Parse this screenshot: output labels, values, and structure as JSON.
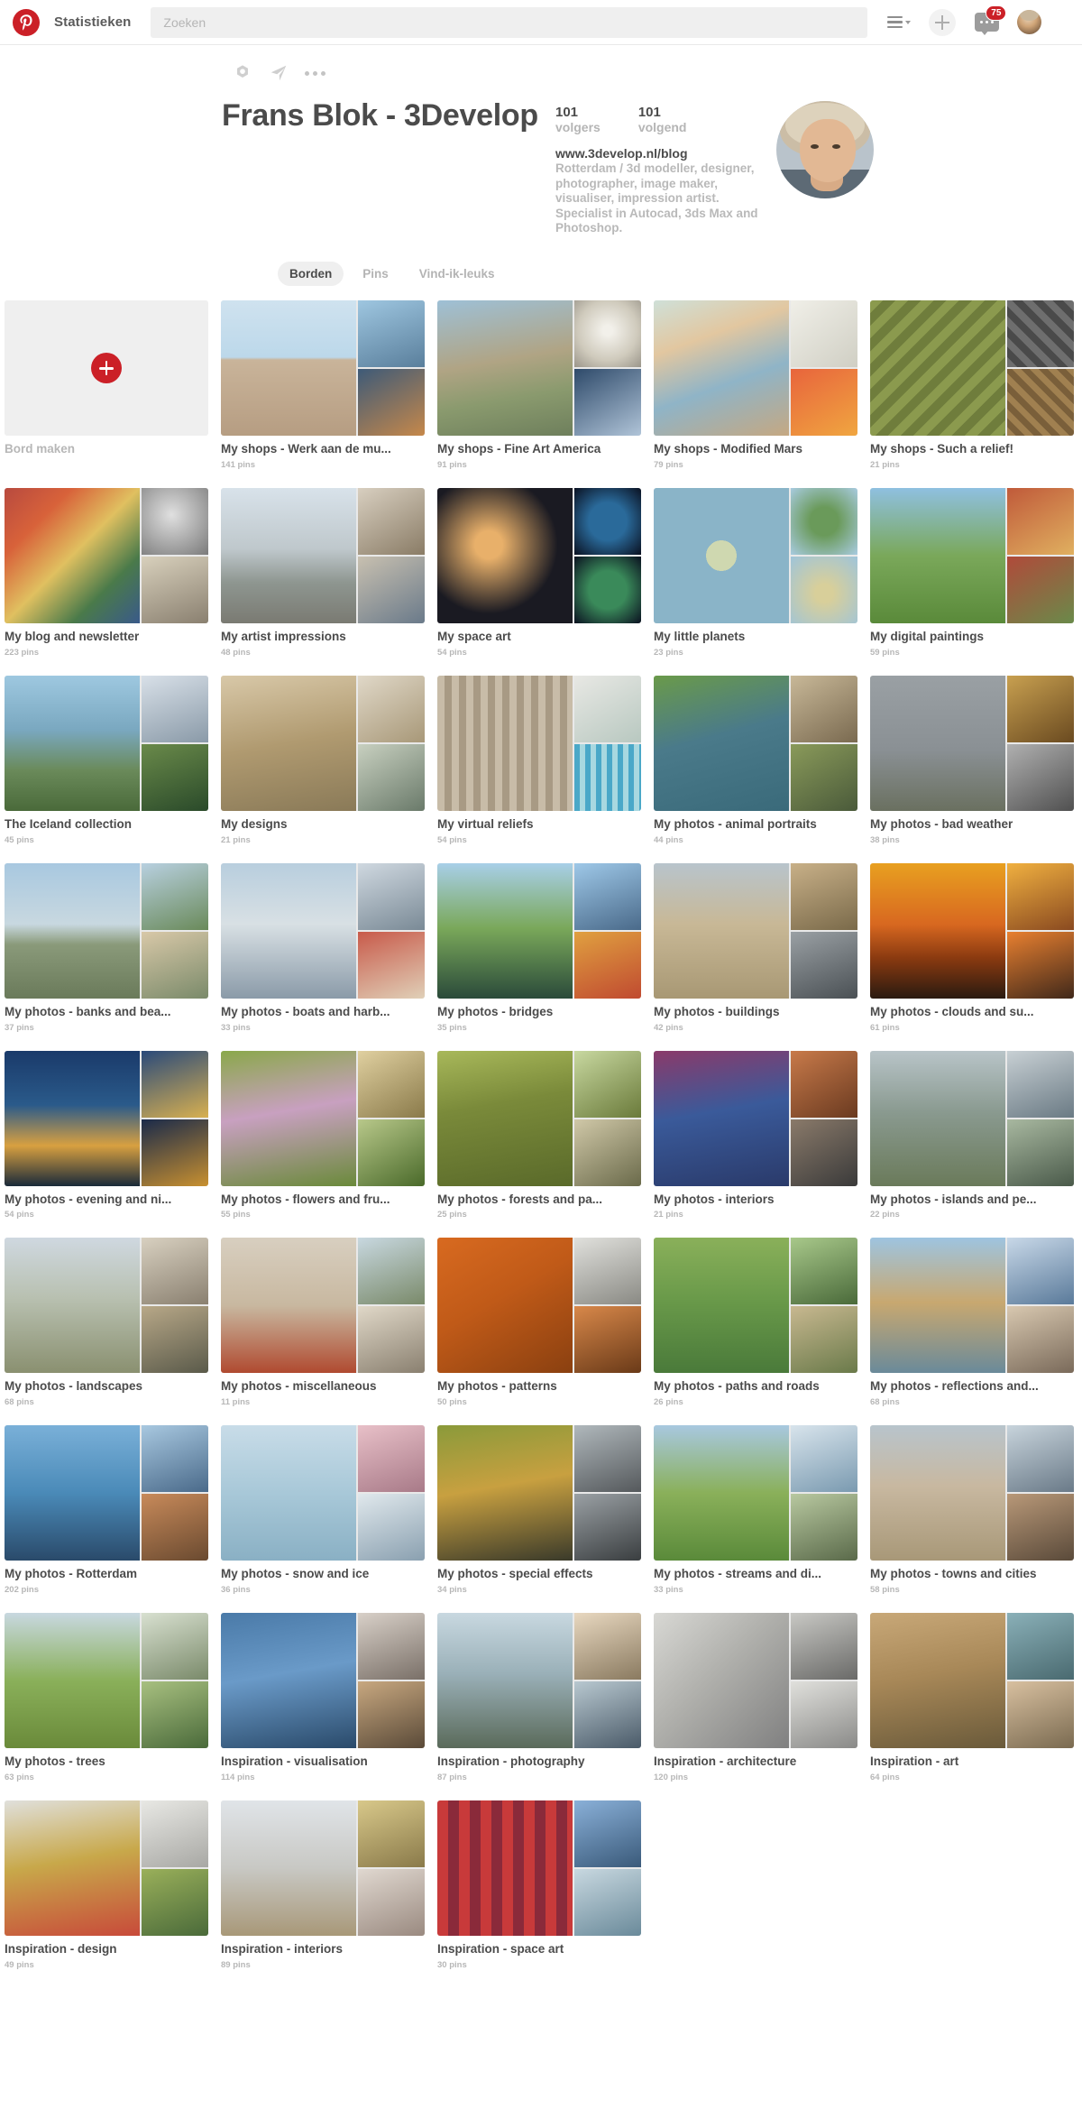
{
  "header": {
    "logo_icon": "pinterest-logo-icon",
    "nav_label": "Statistieken",
    "search_placeholder": "Zoeken",
    "search_value": "",
    "list_icon": "list-view-icon",
    "caret_icon": "chevron-down-icon",
    "add_icon": "plus-icon",
    "messages_icon": "message-bubble-icon",
    "messages_badge": "75",
    "avatar_icon": "user-avatar"
  },
  "profile": {
    "actions": {
      "settings_icon": "gear-icon",
      "share_icon": "send-paper-plane-icon",
      "more_icon": "ellipsis-icon"
    },
    "name": "Frans Blok - 3Develop",
    "followers_count": "101",
    "followers_label": "volgers",
    "following_count": "101",
    "following_label": "volgend",
    "website": "www.3develop.nl/blog",
    "bio": "Rotterdam / 3d modeller, designer, photographer, image maker, visualiser, impression artist. Specialist in Autocad, 3ds Max and Photoshop.",
    "avatar_name": "profile-avatar"
  },
  "tabs": [
    {
      "label": "Borden",
      "active": true
    },
    {
      "label": "Pins",
      "active": false
    },
    {
      "label": "Vind-ik-leuks",
      "active": false
    }
  ],
  "create_board": {
    "label": "Bord maken",
    "icon": "plus-circle-icon"
  },
  "boards": [
    {
      "title": "My shops - Werk aan de mu...",
      "pins": "141 pins",
      "main": "linear-gradient(180deg,#cfe2ef 0%,#bcd8ea 42%,#c9b49a 44%,#b69d82 100%)",
      "s1": "linear-gradient(160deg,#9ec6e0,#5a7f9c)",
      "s2": "linear-gradient(150deg,#3d5a78,#c6884a)"
    },
    {
      "title": "My shops - Fine Art America",
      "pins": "91 pins",
      "main": "linear-gradient(170deg,#9ec0d6 0%,#b0a484 45%,#8a9a6e 70%,#6e7f5c 100%)",
      "s1": "radial-gradient(circle at 50% 45%,#f2f0ea 10%,#cfcabc 60%,#9a958a 100%)",
      "s2": "linear-gradient(150deg,#2e4a6a,#b0c4d8)"
    },
    {
      "title": "My shops - Modified Mars",
      "pins": "79 pins",
      "main": "linear-gradient(160deg,#cfe0d8 0%,#e2c7a0 30%,#8fb4c7 60%,#c5a882 100%)",
      "s1": "linear-gradient(140deg,#f0efe8,#d0cfc4)",
      "s2": "linear-gradient(150deg,#e8643c,#f0a640)"
    },
    {
      "title": "My shops - Such a relief!",
      "pins": "21 pins",
      "main": "repeating-linear-gradient(135deg,#8b9a4e 0 10px,#6f7d3c 10px 20px)",
      "s1": "repeating-linear-gradient(45deg,#6e6e6e 0 8px,#4a4a4a 8px 16px)",
      "s2": "repeating-linear-gradient(45deg,#a08050 0 7px,#7a5f3a 7px 14px)"
    },
    {
      "title": "My blog and newsletter",
      "pins": "223 pins",
      "main": "linear-gradient(135deg,#b84a3f 0%,#d8623a 25%,#e0c060 50%,#4a7a4a 75%,#3a5a8a 100%)",
      "s1": "radial-gradient(circle at 45% 40%,#e0e0e0,#7a7a7a)",
      "s2": "linear-gradient(160deg,#d8d0bc,#8a8070)"
    },
    {
      "title": "My artist impressions",
      "pins": "48 pins",
      "main": "linear-gradient(180deg,#d8e2ea 0%,#bfc8cc 45%,#8e9690 70%,#7a7a72 100%)",
      "s1": "linear-gradient(150deg,#d8cfc0,#8a7c66)",
      "s2": "linear-gradient(150deg,#c8c0b0,#6a7a8a)"
    },
    {
      "title": "My space art",
      "pins": "54 pins",
      "main": "radial-gradient(circle at 38% 42%,#e8b06a 0 12%,#1a1a22 60%)",
      "s1": "radial-gradient(circle at 50% 50%,#2a6a9a 0 40%,#0a1020 100%)",
      "s2": "radial-gradient(circle at 50% 50%,#3a8a5a 0 40%,#0a1020 100%)"
    },
    {
      "title": "My little planets",
      "pins": "23 pins",
      "main": "radial-gradient(circle at 50% 50%,#cfd8b0 0 16%,#8ab4c8 16% 100%)",
      "s1": "radial-gradient(circle at 50% 50%,#6a9a5a 0 30%,#a8cbe0 100%)",
      "s2": "radial-gradient(circle at 50% 55%,#d8cf9a 0 18%,#9ec4da 100%)"
    },
    {
      "title": "My digital paintings",
      "pins": "59 pins",
      "main": "linear-gradient(180deg,#8fc0e0 0%,#7aa85a 50%,#5a8a3a 100%)",
      "s1": "linear-gradient(150deg,#c05a3a,#e0b060)",
      "s2": "linear-gradient(150deg,#b04a3a,#6a8a4a)"
    },
    {
      "title": "The Iceland collection",
      "pins": "45 pins",
      "main": "linear-gradient(180deg,#9ec8e0 0%,#7aa8c0 40%,#6a8a5a 70%,#4a6a3a 100%)",
      "s1": "linear-gradient(160deg,#d8e0e8,#8a9aa8)",
      "s2": "linear-gradient(160deg,#6a8a4a,#2a4a2a)"
    },
    {
      "title": "My designs",
      "pins": "21 pins",
      "main": "linear-gradient(170deg,#d8c8a8 0%,#b09a70 50%,#8a7a58 100%)",
      "s1": "linear-gradient(150deg,#e0d8c8,#a89878)",
      "s2": "linear-gradient(150deg,#c8d0c0,#6a7a6a)"
    },
    {
      "title": "My virtual reliefs",
      "pins": "54 pins",
      "main": "repeating-linear-gradient(90deg,#c8bca8 0 8px,#a89a84 8px 16px)",
      "s1": "linear-gradient(150deg,#e8e8e4,#b8c8c0)",
      "s2": "repeating-linear-gradient(90deg,#4aa8c8 0 6px,#a8d8e0 6px 12px)"
    },
    {
      "title": "My photos - animal portraits",
      "pins": "44 pins",
      "main": "linear-gradient(165deg,#6a9a4a 0%,#4a7a8a 45%,#3a6a7a 100%)",
      "s1": "linear-gradient(150deg,#c8b898,#7a6a50)",
      "s2": "linear-gradient(150deg,#8a9a5a,#4a5a3a)"
    },
    {
      "title": "My photos - bad weather",
      "pins": "38 pins",
      "main": "linear-gradient(180deg,#9aa0a4 0%,#8a9094 55%,#6a7060 100%)",
      "s1": "linear-gradient(150deg,#c8a050,#6a4a20)",
      "s2": "linear-gradient(150deg,#b0b0b0,#505050)"
    },
    {
      "title": "My photos - banks and bea...",
      "pins": "37 pins",
      "main": "linear-gradient(180deg,#a8c8e0 0%,#c8d8e0 45%,#8a9a7a 60%,#6a7a5a 100%)",
      "s1": "linear-gradient(160deg,#b8d0e0,#6a8a5a)",
      "s2": "linear-gradient(160deg,#d8c8a8,#7a8a6a)"
    },
    {
      "title": "My photos - boats and harb...",
      "pins": "33 pins",
      "main": "linear-gradient(180deg,#b8cede 0%,#d8e0e4 45%,#8a9aa8 100%)",
      "s1": "linear-gradient(160deg,#cfd8e0,#7a8a96)",
      "s2": "linear-gradient(160deg,#c85a4a,#e0d0b8)"
    },
    {
      "title": "My photos - bridges",
      "pins": "35 pins",
      "main": "linear-gradient(180deg,#a8cfe8 0%,#7aa85a 48%,#2a4a3a 100%)",
      "s1": "linear-gradient(160deg,#9ec8e8,#4a6a8a)",
      "s2": "linear-gradient(160deg,#e0a040,#c04a30)"
    },
    {
      "title": "My photos - buildings",
      "pins": "42 pins",
      "main": "linear-gradient(180deg,#b8c4cc 0%,#c8b896 45%,#a89874 100%)",
      "s1": "linear-gradient(160deg,#c8b088,#7a6a4a)",
      "s2": "linear-gradient(160deg,#9aa0a4,#4a5054)"
    },
    {
      "title": "My photos - clouds and su...",
      "pins": "61 pins",
      "main": "linear-gradient(180deg,#e8a020 0%,#d86820 45%,#8a3a10 70%,#2a1a10 100%)",
      "s1": "linear-gradient(160deg,#f0b040,#8a4a20)",
      "s2": "linear-gradient(160deg,#e88030,#40281a)"
    },
    {
      "title": "My photos - evening and ni...",
      "pins": "54 pins",
      "main": "linear-gradient(180deg,#1a3a6a 0%,#2a5a8a 40%,#d8a040 70%,#1a2a3a 100%)",
      "s1": "linear-gradient(160deg,#2a4a7a,#d8b050)",
      "s2": "linear-gradient(160deg,#1a2a4a,#c89030)"
    },
    {
      "title": "My photos - flowers and fru...",
      "pins": "55 pins",
      "main": "linear-gradient(170deg,#8aa84a 0%,#c8a0c0 45%,#6a8a3a 100%)",
      "s1": "linear-gradient(150deg,#e0d0a0,#8a7a4a)",
      "s2": "linear-gradient(150deg,#b8c88a,#4a6a2a)"
    },
    {
      "title": "My photos - forests and pa...",
      "pins": "25 pins",
      "main": "linear-gradient(170deg,#a8b85a 0%,#7a8a3a 40%,#5a6a2a 100%)",
      "s1": "linear-gradient(150deg,#c8d8a0,#6a7a3a)",
      "s2": "linear-gradient(150deg,#d0c8a8,#6a6a4a)"
    },
    {
      "title": "My photos - interiors",
      "pins": "21 pins",
      "main": "linear-gradient(170deg,#8a3a6a 0%,#3a5a9a 45%,#2a3a6a 100%)",
      "s1": "linear-gradient(150deg,#c87a4a,#6a3a20)",
      "s2": "linear-gradient(150deg,#8a7a6a,#3a3a3a)"
    },
    {
      "title": "My photos - islands and pe...",
      "pins": "22 pins",
      "main": "linear-gradient(180deg,#b8c4c8 0%,#8a9a90 45%,#6a7a5a 100%)",
      "s1": "linear-gradient(160deg,#c8d0d4,#6a7a84)",
      "s2": "linear-gradient(160deg,#a8b8a0,#4a5a4a)"
    },
    {
      "title": "My photos - landscapes",
      "pins": "68 pins",
      "main": "linear-gradient(180deg,#cfd8e0 0%,#b8c0b0 45%,#8a9070 100%)",
      "s1": "linear-gradient(160deg,#d8d0c0,#8a8070)",
      "s2": "linear-gradient(160deg,#b8a888,#5a5a4a)"
    },
    {
      "title": "My photos - miscellaneous",
      "pins": "11 pins",
      "main": "linear-gradient(180deg,#d8cfc0 0%,#c8b8a0 50%,#b04a30 100%)",
      "s1": "linear-gradient(160deg,#c8d8e0,#7a8a6a)",
      "s2": "linear-gradient(160deg,#e0d8c8,#8a8070)"
    },
    {
      "title": "My photos - patterns",
      "pins": "50 pins",
      "main": "linear-gradient(150deg,#d86a20 0%,#c05a18 45%,#8a4010 100%)",
      "s1": "linear-gradient(160deg,#e0e0dc,#8a8a84)",
      "s2": "linear-gradient(160deg,#d8884a,#6a3a18)"
    },
    {
      "title": "My photos - paths and roads",
      "pins": "26 pins",
      "main": "linear-gradient(180deg,#8ab05a 0%,#6a9a4a 45%,#4a7a3a 100%)",
      "s1": "linear-gradient(160deg,#a8c88a,#4a6a3a)",
      "s2": "linear-gradient(160deg,#c8b890,#6a7a4a)"
    },
    {
      "title": "My photos - reflections and...",
      "pins": "68 pins",
      "main": "linear-gradient(180deg,#9ec4e0 0%,#c8a870 48%,#6a8a9a 100%)",
      "s1": "linear-gradient(160deg,#c8d8e8,#5a7a9a)",
      "s2": "linear-gradient(160deg,#d8c8b0,#7a6a5a)"
    },
    {
      "title": "My photos - Rotterdam",
      "pins": "202 pins",
      "main": "linear-gradient(180deg,#7ab0d8 0%,#4a8ab8 50%,#2a4a6a 100%)",
      "s1": "linear-gradient(160deg,#a8c8e0,#4a6a8a)",
      "s2": "linear-gradient(160deg,#c88a5a,#6a4a30)"
    },
    {
      "title": "My photos - snow and ice",
      "pins": "36 pins",
      "main": "linear-gradient(180deg,#c8dce8 0%,#a8c8d8 50%,#8ab0c4 100%)",
      "s1": "linear-gradient(160deg,#e8c0c8,#a87a88)",
      "s2": "linear-gradient(160deg,#e0e8ec,#8aa0b0)"
    },
    {
      "title": "My photos - special effects",
      "pins": "34 pins",
      "main": "linear-gradient(170deg,#8a9a3a 0%,#c8a040 45%,#3a3a2a 100%)",
      "s1": "linear-gradient(160deg,#b0b8bc,#55595c)",
      "s2": "linear-gradient(160deg,#9aa0a4,#3a3e40)"
    },
    {
      "title": "My photos - streams and di...",
      "pins": "33 pins",
      "main": "linear-gradient(180deg,#a8c8e0 0%,#8ab05a 50%,#5a8a3a 100%)",
      "s1": "linear-gradient(160deg,#d8e4ec,#7a9ab0)",
      "s2": "linear-gradient(160deg,#b8c8a0,#5a6a4a)"
    },
    {
      "title": "My photos - towns and cities",
      "pins": "58 pins",
      "main": "linear-gradient(180deg,#b8c4cc 0%,#c8b8a0 45%,#a89878 100%)",
      "s1": "linear-gradient(160deg,#c8d4dc,#6a7a88)",
      "s2": "linear-gradient(160deg,#b89878,#5a4a3a)"
    },
    {
      "title": "My photos - trees",
      "pins": "63 pins",
      "main": "linear-gradient(180deg,#c8d8e0 0%,#8ab05a 50%,#6a8a3a 100%)",
      "s1": "linear-gradient(160deg,#d8e0d0,#7a8a6a)",
      "s2": "linear-gradient(160deg,#a8c080,#4a6a3a)"
    },
    {
      "title": "Inspiration - visualisation",
      "pins": "114 pins",
      "main": "linear-gradient(170deg,#4a7aa8 0%,#6a9ac8 45%,#2a4a6a 100%)",
      "s1": "linear-gradient(160deg,#d8d0c8,#7a7068)",
      "s2": "linear-gradient(160deg,#c8a880,#5a4a38)"
    },
    {
      "title": "Inspiration - photography",
      "pins": "87 pins",
      "main": "linear-gradient(180deg,#c8d8e0 0%,#9ab0b8 45%,#5a6a5a 100%)",
      "s1": "linear-gradient(160deg,#e8d8c0,#8a7a60)",
      "s2": "linear-gradient(160deg,#b8c8d0,#4a5a68)"
    },
    {
      "title": "Inspiration - architecture",
      "pins": "120 pins",
      "main": "linear-gradient(135deg,#d8d8d4 0%,#b0b0ac 45%,#808080 100%)",
      "s1": "linear-gradient(160deg,#c8c8c4,#6a6a68)",
      "s2": "linear-gradient(160deg,#e0e0dc,#8a8a88)"
    },
    {
      "title": "Inspiration - art",
      "pins": "64 pins",
      "main": "linear-gradient(170deg,#c8a878 0%,#a88858 45%,#6a5a3a 100%)",
      "s1": "linear-gradient(160deg,#8ab0b8,#4a6a70)",
      "s2": "linear-gradient(160deg,#d8c0a0,#7a6a50)"
    },
    {
      "title": "Inspiration - design",
      "pins": "49 pins",
      "main": "linear-gradient(170deg,#e0e0dc 0%,#c8a84a 45%,#c84a3a 100%)",
      "s1": "linear-gradient(160deg,#e8e8e4,#a8a8a4)",
      "s2": "linear-gradient(160deg,#9ab05a,#4a6a3a)"
    },
    {
      "title": "Inspiration - interiors",
      "pins": "89 pins",
      "main": "linear-gradient(180deg,#e0e4e8 0%,#c8c8c4 50%,#a89878 100%)",
      "s1": "linear-gradient(160deg,#d8c88a,#8a7a4a)",
      "s2": "linear-gradient(160deg,#e0d8d0,#9a8a80)"
    },
    {
      "title": "Inspiration - space art",
      "pins": "30 pins",
      "main": "repeating-linear-gradient(90deg,#c83a3a 0 12px,#8a2a3a 12px 24px)",
      "s1": "linear-gradient(160deg,#8ab0d8,#3a5a7a)",
      "s2": "linear-gradient(160deg,#c8d8e0,#6a8a9a)"
    }
  ]
}
